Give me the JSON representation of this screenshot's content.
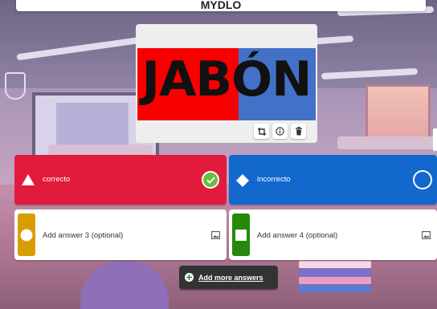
{
  "question": {
    "title": "MYDLO"
  },
  "media": {
    "image_text": "JABÓN",
    "image_colors": {
      "left": "#f90000",
      "right": "#4371c8"
    },
    "tools": [
      "crop-icon",
      "info-icon",
      "trash-icon"
    ]
  },
  "answers": [
    {
      "text": "correcto",
      "color": "#e21b3c",
      "shape": "triangle",
      "marked_correct": true
    },
    {
      "text": "incorrecto",
      "color": "#1368ce",
      "shape": "diamond",
      "marked_correct": false
    },
    {
      "placeholder": "Add answer 3 (optional)",
      "color": "#d89e00",
      "shape": "circle"
    },
    {
      "placeholder": "Add answer 4 (optional)",
      "color": "#26890c",
      "shape": "square"
    }
  ],
  "add_more": {
    "label": "Add more answers"
  }
}
